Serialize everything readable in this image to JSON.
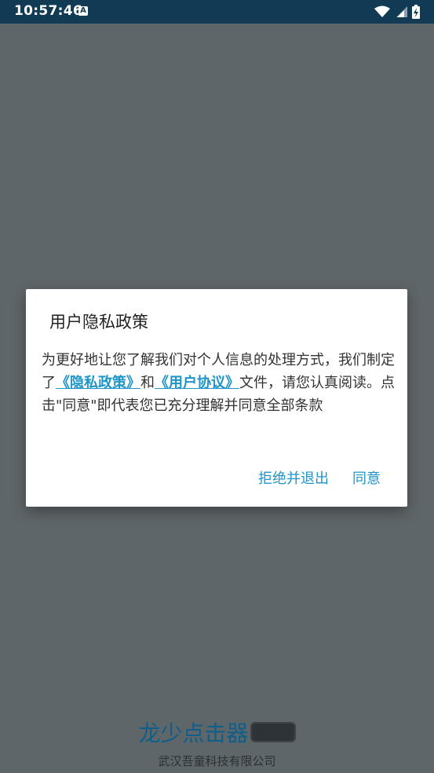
{
  "status_bar": {
    "time": "10:57:46",
    "notification_icon": "a-icon",
    "icons": [
      "wifi-icon",
      "signal-icon",
      "battery-icon"
    ]
  },
  "app": {
    "name": "龙少点击器",
    "company": "武汉吾童科技有限公司"
  },
  "dialog": {
    "title": "用户隐私政策",
    "body_part1": "为更好地让您了解我们对个人信息的处理方式，我们制定了",
    "privacy_link": "《隐私政策》",
    "body_and": "和",
    "terms_link": "《用户协议》",
    "body_part2": "文件，请您认真阅读。点击\"同意\"即代表您已充分理解并同意全部条款",
    "decline_label": "拒绝并退出",
    "agree_label": "同意"
  },
  "colors": {
    "status_bar": "#113a55",
    "overlay_bg": "#5f6669",
    "accent": "#1e95c8"
  }
}
